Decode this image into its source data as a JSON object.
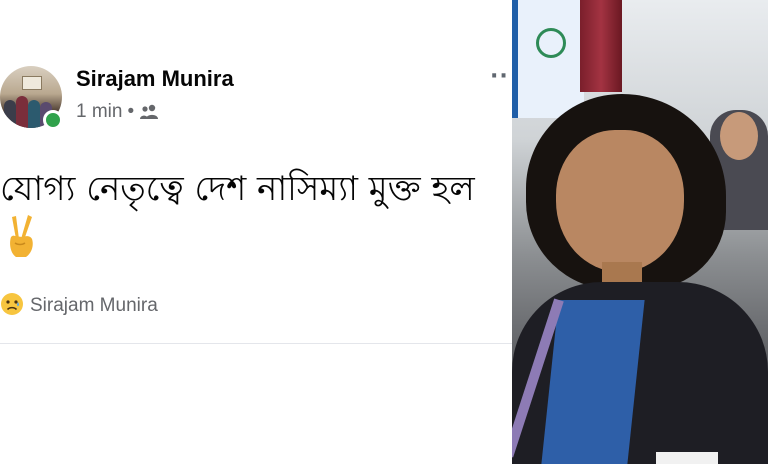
{
  "post": {
    "author_name": "Sirajam Munira",
    "timestamp": "1 min",
    "separator": "•",
    "audience_icon": "friends-icon",
    "more_icon": "more-horizontal-icon",
    "more_label": "··",
    "text": "যোগ্য নেতৃত্বে দেশ নাসিম্যা মুক্ত হল",
    "emoji": "victory-hand",
    "reaction": {
      "emoji": "sad-face",
      "name": "Sirajam Munira"
    },
    "online": true,
    "colors": {
      "name": "#050505",
      "secondary": "#65676b",
      "online": "#31a24c",
      "divider": "#e4e6eb"
    }
  },
  "photo": {
    "subject": "woman-portrait"
  }
}
